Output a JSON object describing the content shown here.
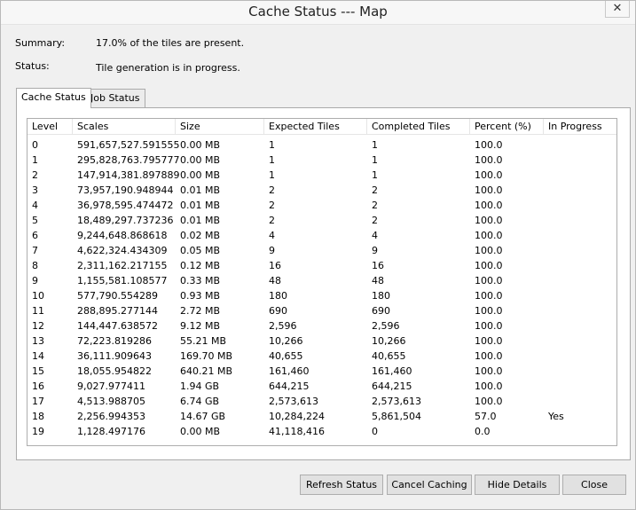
{
  "window": {
    "title": "Cache Status --- Map",
    "close_glyph": "✕"
  },
  "summary": {
    "label": "Summary:",
    "value": "17.0% of the tiles are present."
  },
  "status": {
    "label": "Status:",
    "value": "Tile generation is in progress."
  },
  "tabs": [
    {
      "label": "Cache Status",
      "active": true
    },
    {
      "label": "Job Status",
      "active": false
    }
  ],
  "table": {
    "columns": [
      "Level",
      "Scales",
      "Size",
      "Expected Tiles",
      "Completed Tiles",
      "Percent (%)",
      "In Progress"
    ],
    "rows": [
      [
        "0",
        "591,657,527.591555",
        "0.00 MB",
        "1",
        "1",
        "100.0",
        ""
      ],
      [
        "1",
        "295,828,763.795777",
        "0.00 MB",
        "1",
        "1",
        "100.0",
        ""
      ],
      [
        "2",
        "147,914,381.897889",
        "0.00 MB",
        "1",
        "1",
        "100.0",
        ""
      ],
      [
        "3",
        "73,957,190.948944",
        "0.01 MB",
        "2",
        "2",
        "100.0",
        ""
      ],
      [
        "4",
        "36,978,595.474472",
        "0.01 MB",
        "2",
        "2",
        "100.0",
        ""
      ],
      [
        "5",
        "18,489,297.737236",
        "0.01 MB",
        "2",
        "2",
        "100.0",
        ""
      ],
      [
        "6",
        "9,244,648.868618",
        "0.02 MB",
        "4",
        "4",
        "100.0",
        ""
      ],
      [
        "7",
        "4,622,324.434309",
        "0.05 MB",
        "9",
        "9",
        "100.0",
        ""
      ],
      [
        "8",
        "2,311,162.217155",
        "0.12 MB",
        "16",
        "16",
        "100.0",
        ""
      ],
      [
        "9",
        "1,155,581.108577",
        "0.33 MB",
        "48",
        "48",
        "100.0",
        ""
      ],
      [
        "10",
        "577,790.554289",
        "0.93 MB",
        "180",
        "180",
        "100.0",
        ""
      ],
      [
        "11",
        "288,895.277144",
        "2.72 MB",
        "690",
        "690",
        "100.0",
        ""
      ],
      [
        "12",
        "144,447.638572",
        "9.12 MB",
        "2,596",
        "2,596",
        "100.0",
        ""
      ],
      [
        "13",
        "72,223.819286",
        "55.21 MB",
        "10,266",
        "10,266",
        "100.0",
        ""
      ],
      [
        "14",
        "36,111.909643",
        "169.70 MB",
        "40,655",
        "40,655",
        "100.0",
        ""
      ],
      [
        "15",
        "18,055.954822",
        "640.21 MB",
        "161,460",
        "161,460",
        "100.0",
        ""
      ],
      [
        "16",
        "9,027.977411",
        "1.94 GB",
        "644,215",
        "644,215",
        "100.0",
        ""
      ],
      [
        "17",
        "4,513.988705",
        "6.74 GB",
        "2,573,613",
        "2,573,613",
        "100.0",
        ""
      ],
      [
        "18",
        "2,256.994353",
        "14.67 GB",
        "10,284,224",
        "5,861,504",
        "57.0",
        "Yes"
      ],
      [
        "19",
        "1,128.497176",
        "0.00 MB",
        "41,118,416",
        "0",
        "0.0",
        ""
      ]
    ]
  },
  "buttons": {
    "refresh": "Refresh Status",
    "cancel": "Cancel Caching",
    "hide": "Hide Details",
    "close": "Close"
  }
}
